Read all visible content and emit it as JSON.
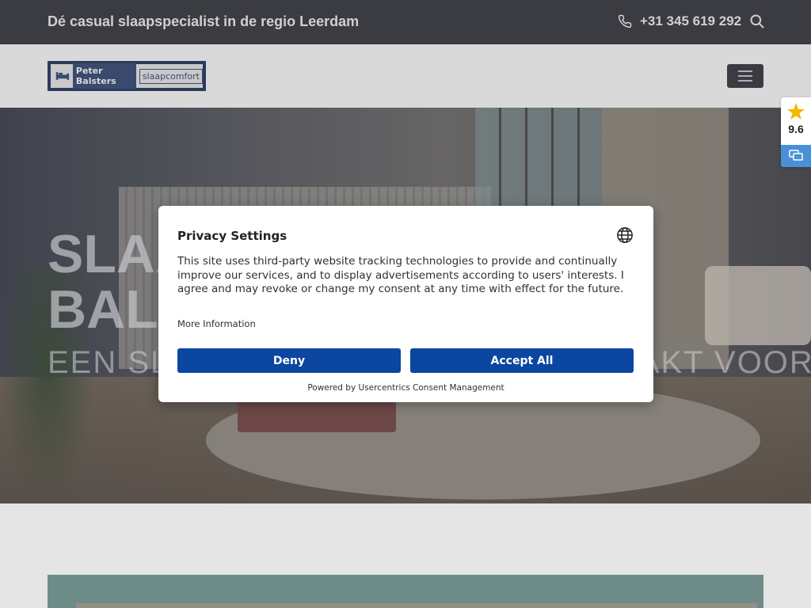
{
  "topbar": {
    "tagline": "Dé casual slaapspecialist in de regio Leerdam",
    "phone": "+31 345 619 292",
    "phone_icon": "phone-icon",
    "search_icon": "search-icon"
  },
  "header": {
    "logo_name": "Peter Balsters",
    "logo_sub": "slaapcomfort",
    "menu_icon": "menu-icon"
  },
  "hero": {
    "title_line1": "SLAAPCOMFORT",
    "title_line2": "BALSTERS LEERDAM:",
    "subtitle": "EEN SLAAPWINKEL OP MAAT GEMAAKT VOOR IEDEREEN"
  },
  "rating": {
    "score": "9.6",
    "star_color": "#f5b800",
    "chat_color": "#4a90d9"
  },
  "consent": {
    "title": "Privacy Settings",
    "body": "This site uses third-party website tracking technologies to provide and continually improve our services, and to display advertisements according to users' interests. I agree and may revoke or change my consent at any time with effect for the future.",
    "more": "More Information",
    "deny": "Deny",
    "accept": "Accept All",
    "powered": "Powered by Usercentrics Consent Management",
    "button_color": "#0b46a0"
  }
}
